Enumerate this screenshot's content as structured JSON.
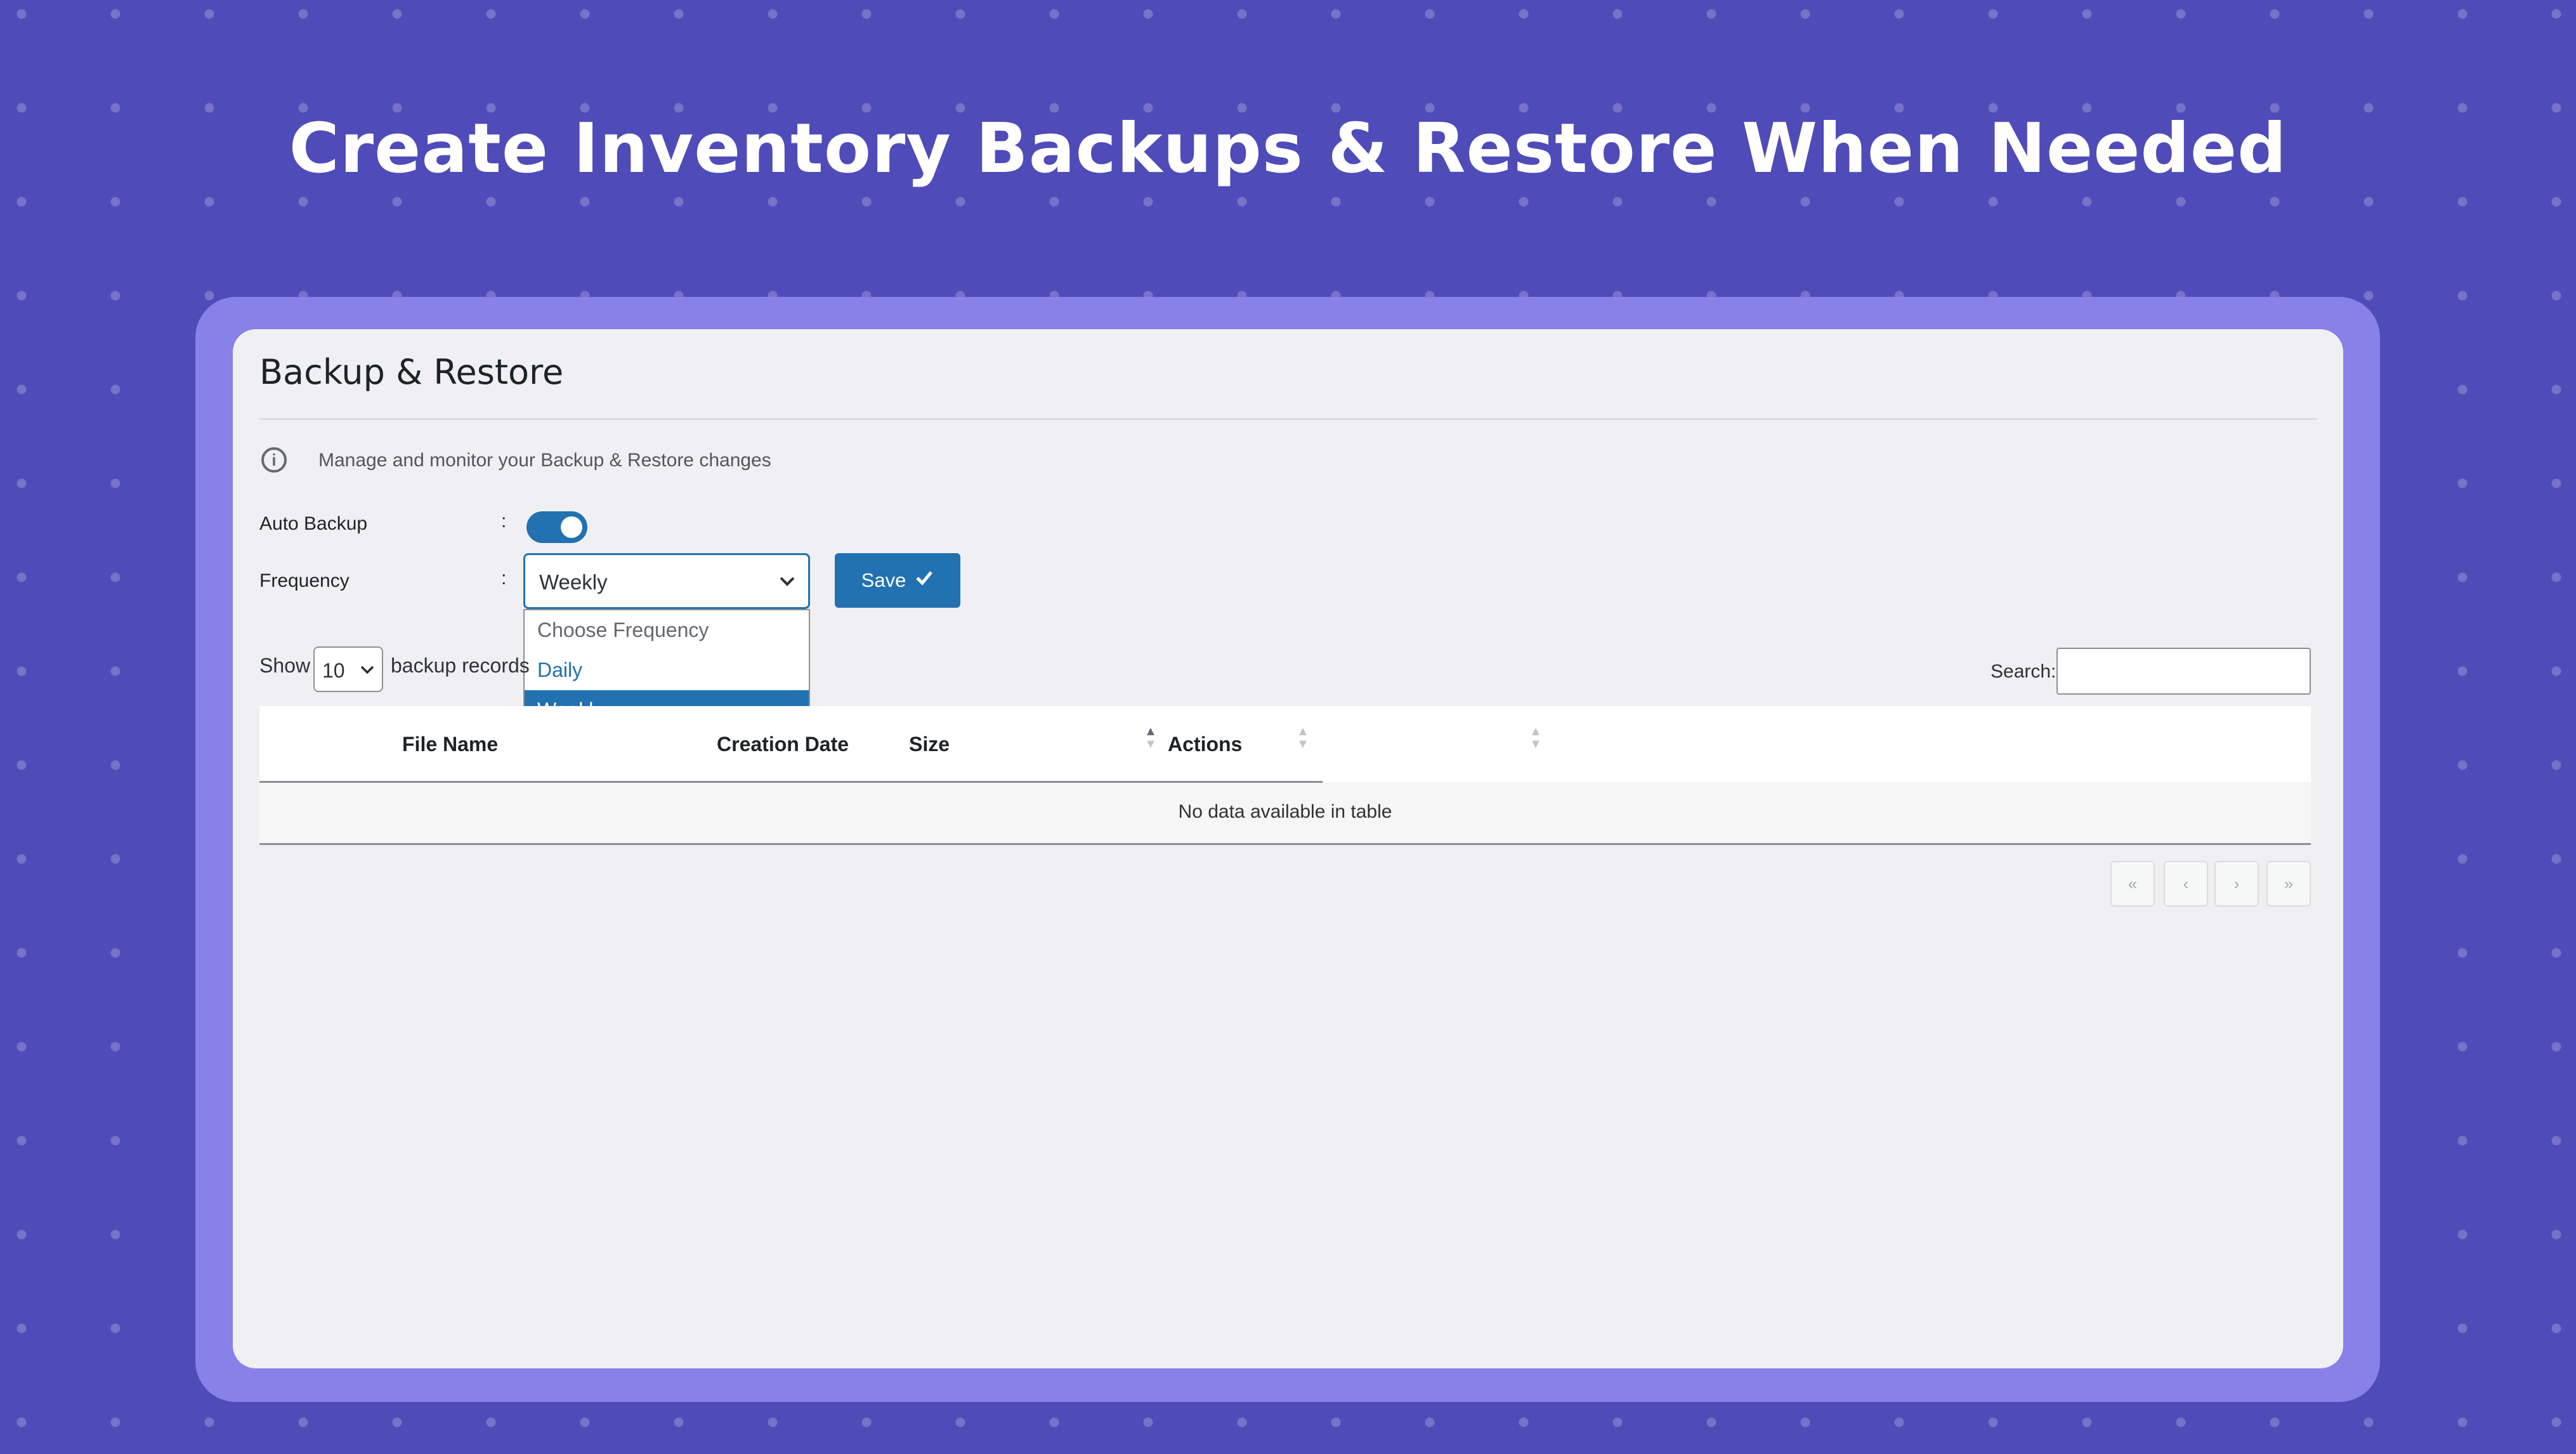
{
  "headline": "Create Inventory Backups & Restore When Needed",
  "panel": {
    "title": "Backup & Restore",
    "info_text": "Manage and monitor your Backup & Restore changes"
  },
  "form": {
    "auto_backup_label": "Auto Backup",
    "auto_backup_enabled": true,
    "frequency_label": "Frequency",
    "colon": ":",
    "frequency_value": "Weekly",
    "frequency_options": [
      "Choose Frequency",
      "Daily",
      "Weekly"
    ],
    "save_label": "Save"
  },
  "table_controls": {
    "show_label": "Show",
    "page_length": "10",
    "records_label": "backup records",
    "search_label": "Search:"
  },
  "table": {
    "columns": [
      "File Name",
      "Creation Date",
      "Size",
      "Actions"
    ],
    "empty_message": "No data available in table"
  },
  "pagination": {
    "first": "«",
    "prev": "‹",
    "next": "›",
    "last": "»"
  },
  "colors": {
    "background": "#4f4bb9",
    "frame": "#8781e8",
    "accent": "#2271b1"
  }
}
